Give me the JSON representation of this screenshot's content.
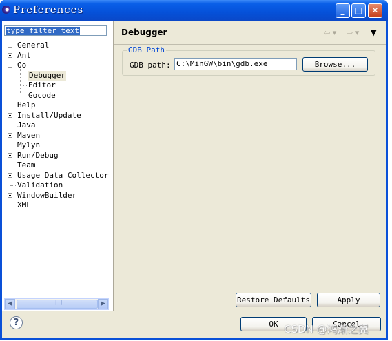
{
  "window": {
    "title": "Preferences"
  },
  "filter": {
    "text": "type filter text"
  },
  "tree": {
    "items": [
      {
        "label": "General"
      },
      {
        "label": "Ant"
      },
      {
        "label": "Go"
      },
      {
        "label": "Debugger"
      },
      {
        "label": "Editor"
      },
      {
        "label": "Gocode"
      },
      {
        "label": "Help"
      },
      {
        "label": "Install/Update"
      },
      {
        "label": "Java"
      },
      {
        "label": "Maven"
      },
      {
        "label": "Mylyn"
      },
      {
        "label": "Run/Debug"
      },
      {
        "label": "Team"
      },
      {
        "label": "Usage Data Collector"
      },
      {
        "label": "Validation"
      },
      {
        "label": "WindowBuilder"
      },
      {
        "label": "XML"
      }
    ]
  },
  "page": {
    "title": "Debugger",
    "group_title": "GDB Path",
    "gdb_label": "GDB path:",
    "gdb_value": "C:\\MinGW\\bin\\gdb.exe",
    "browse_label": "Browse..."
  },
  "buttons": {
    "restore_defaults": "Restore Defaults",
    "apply": "Apply",
    "ok": "OK",
    "cancel": "Cancel",
    "help": "?"
  },
  "watermark": "CSDN @鸿渐之翼"
}
